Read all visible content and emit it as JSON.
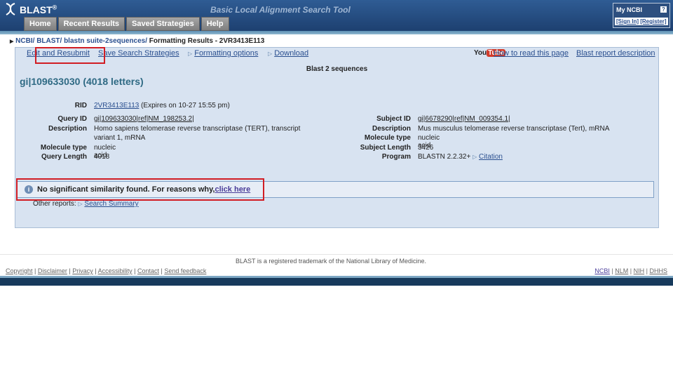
{
  "header": {
    "logo_text": "BLAST",
    "logo_mark": "®",
    "tool_title": "Basic Local Alignment Search Tool",
    "nav": [
      "Home",
      "Recent Results",
      "Saved Strategies",
      "Help"
    ],
    "myncbi": {
      "title": "My NCBI",
      "help": "?",
      "sign_in": "[Sign In]",
      "register": "[Register]"
    }
  },
  "breadcrumb": {
    "items": [
      "NCBI/",
      "BLAST/",
      "blastn suite-2sequences/"
    ],
    "current": "Formatting Results - 2VR3413E113"
  },
  "toolbar": {
    "edit_resubmit": "Edit and Resubmit",
    "save_strategies": "Save Search Strategies",
    "formatting_options": "Formatting options",
    "download": "Download",
    "youtube_you": "You",
    "youtube_tube": "Tube",
    "how_to_read": "How to read this page",
    "report_description": "Blast report description"
  },
  "report": {
    "title": "Blast 2 sequences",
    "query_title": "gi|109633030 (4018 letters)",
    "rid_label": "RID",
    "rid_value": "2VR3413E113",
    "rid_expiry": "(Expires on 10-27 15:55 pm)",
    "query": {
      "id_label": "Query ID",
      "id_value": "gi|109633030|ref|NM_198253.2|",
      "desc_label": "Description",
      "desc_line1": "Homo sapiens telomerase reverse transcriptase (TERT), transcript",
      "desc_line2": "variant 1, mRNA",
      "mol_label": "Molecule type",
      "mol_value": "nucleic acid",
      "len_label": "Query Length",
      "len_value": "4018"
    },
    "subject": {
      "id_label": "Subject ID",
      "id_value": "gi|6678290|ref|NM_009354.1|",
      "desc_label": "Description",
      "desc_value": "Mus musculus telomerase reverse transcriptase (Tert), mRNA",
      "mol_label": "Molecule type",
      "mol_value": "nucleic acid",
      "len_label": "Subject Length",
      "len_value": "3426",
      "prog_label": "Program",
      "prog_value": "BLASTN 2.2.32+",
      "citation": "Citation"
    },
    "notice_text": "No significant similarity found. For reasons why,",
    "notice_link": "click here",
    "other_reports_label": "Other reports:",
    "search_summary": "Search Summary"
  },
  "footer": {
    "trademark": "BLAST is a registered trademark of the National Library of Medicine.",
    "links": [
      "Copyright",
      "Disclaimer",
      "Privacy",
      "Accessibility",
      "Contact",
      "Send feedback"
    ],
    "right_links": [
      "NCBI",
      "NLM",
      "NIH",
      "DHHS"
    ]
  },
  "colors": {
    "highlight": "#d11d24",
    "panel": "#d8e3f1",
    "header": "#1d4070",
    "link": "#2a4f8f"
  }
}
